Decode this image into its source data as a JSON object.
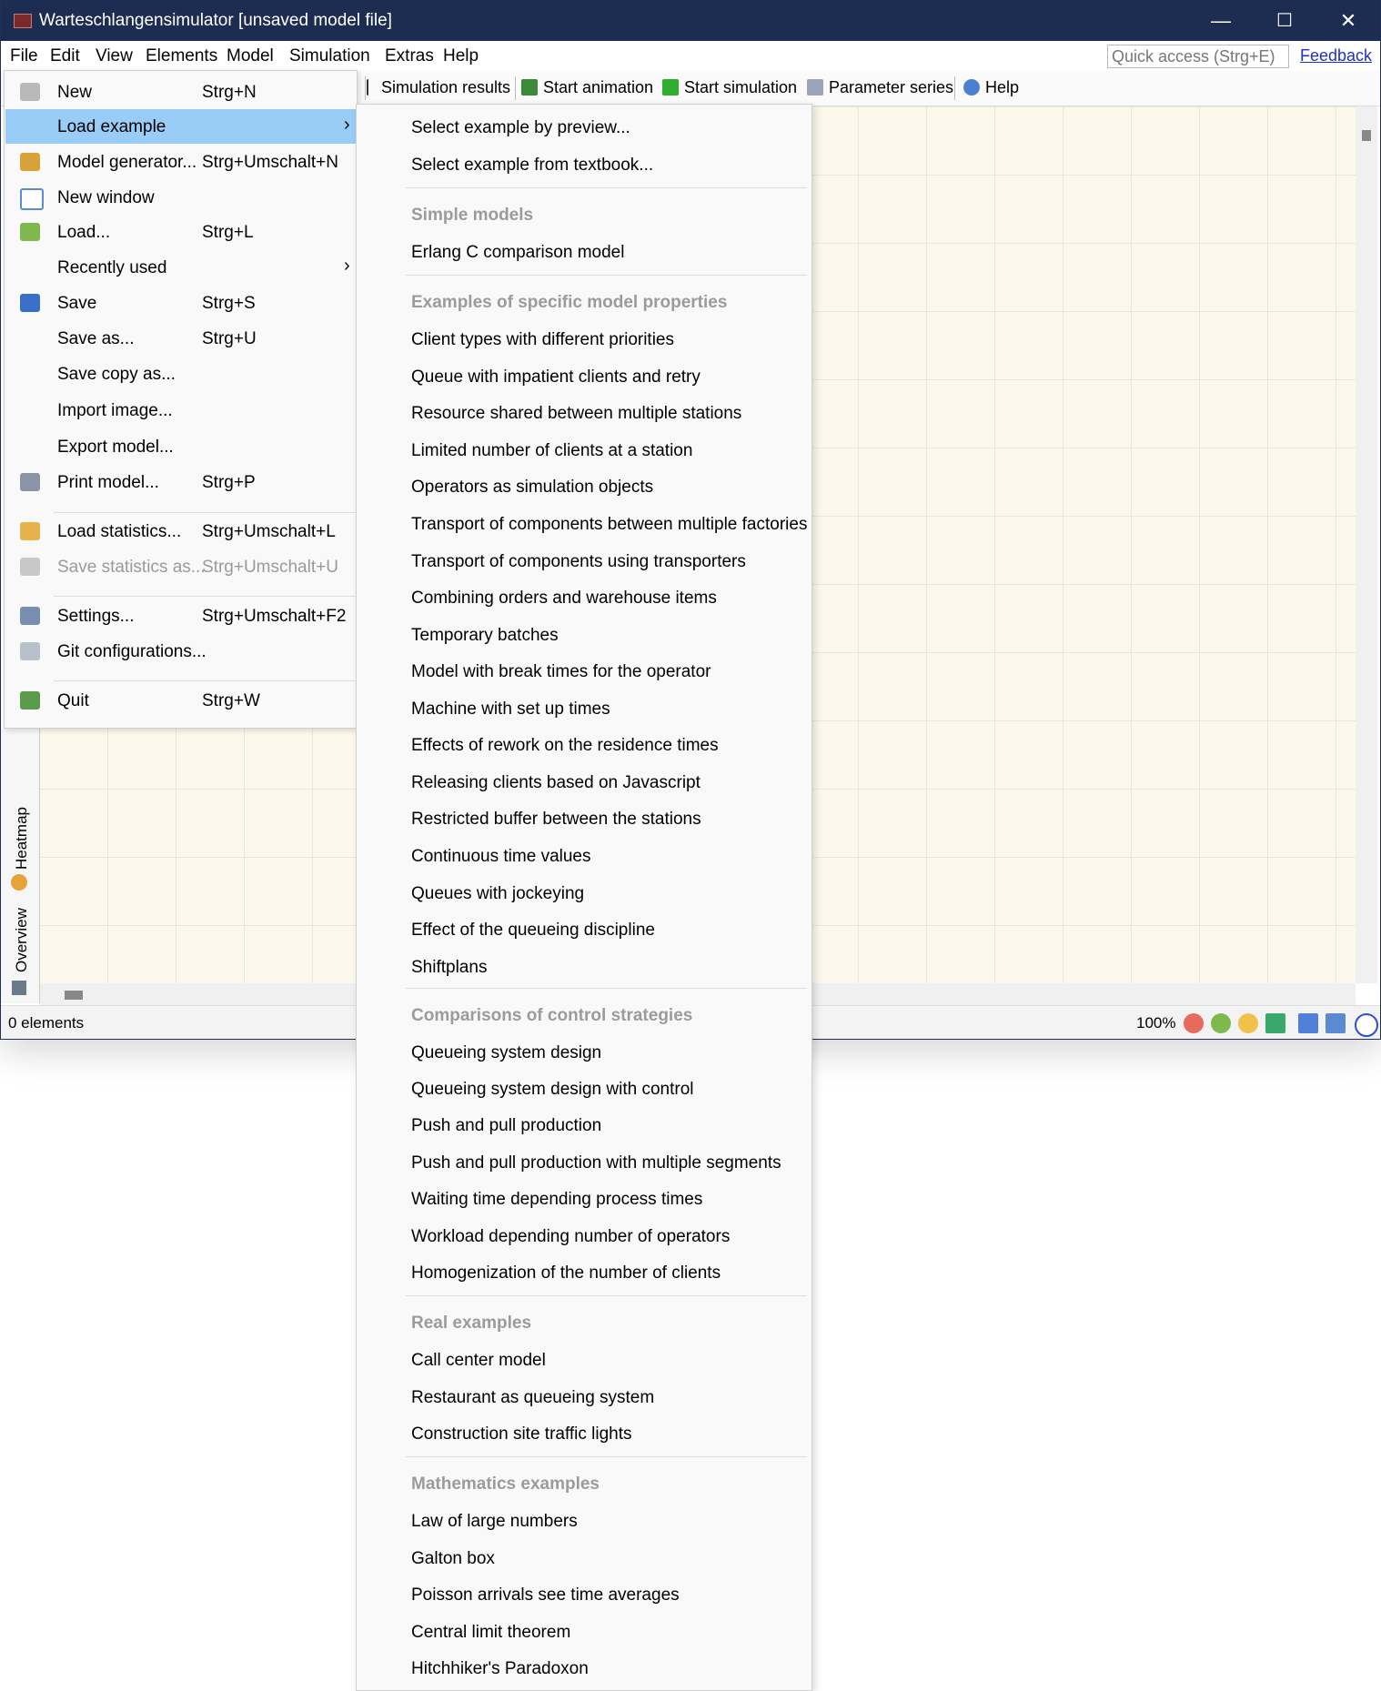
{
  "window": {
    "title": "Warteschlangensimulator [unsaved model file]"
  },
  "window_controls": {
    "minimize": "—",
    "maximize": "☐",
    "close": "✕"
  },
  "menubar": [
    "File",
    "Edit",
    "View",
    "Elements",
    "Model",
    "Simulation",
    "Extras",
    "Help"
  ],
  "quick_access": {
    "placeholder": "Quick access (Strg+E)"
  },
  "feedback": "Feedback",
  "toolbar": {
    "simulation_results": "Simulation results",
    "start_animation": "Start animation",
    "start_simulation": "Start simulation",
    "parameter_series": "Parameter series",
    "help": "Help"
  },
  "file_menu": {
    "items": [
      {
        "label": "New",
        "shortcut": "Strg+N"
      },
      {
        "label": "Load example",
        "shortcut": "",
        "arrow": "›"
      },
      {
        "label": "Model generator...",
        "shortcut": "Strg+Umschalt+N"
      },
      {
        "label": "New window",
        "shortcut": ""
      },
      {
        "label": "Load...",
        "shortcut": "Strg+L"
      },
      {
        "label": "Recently used",
        "shortcut": "",
        "arrow": "›"
      },
      {
        "label": "Save",
        "shortcut": "Strg+S"
      },
      {
        "label": "Save as...",
        "shortcut": "Strg+U"
      },
      {
        "label": "Save copy as...",
        "shortcut": ""
      },
      {
        "label": "Import image...",
        "shortcut": ""
      },
      {
        "label": "Export model...",
        "shortcut": ""
      },
      {
        "label": "Print model...",
        "shortcut": "Strg+P"
      },
      {
        "label": "Load statistics...",
        "shortcut": "Strg+Umschalt+L"
      },
      {
        "label": "Save statistics as...",
        "shortcut": "Strg+Umschalt+U"
      },
      {
        "label": "Settings...",
        "shortcut": "Strg+Umschalt+F2"
      },
      {
        "label": "Git configurations...",
        "shortcut": ""
      },
      {
        "label": "Quit",
        "shortcut": "Strg+W"
      }
    ]
  },
  "submenu": {
    "items": [
      "Select example by preview...",
      "Select example from textbook...",
      "Simple models",
      "Erlang C comparison model",
      "Examples of specific model properties",
      "Client types with different priorities",
      "Queue with impatient clients and retry",
      "Resource shared between multiple stations",
      "Limited number of clients at a station",
      "Operators as simulation objects",
      "Transport of components between multiple factories",
      "Transport of components using transporters",
      "Combining orders and warehouse items",
      "Temporary batches",
      "Model with break times for the operator",
      "Machine with set up times",
      "Effects of rework on the residence times",
      "Releasing clients based on Javascript",
      "Restricted buffer between the stations",
      "Continuous time values",
      "Queues with jockeying",
      "Effect of the queueing discipline",
      "Shiftplans",
      "Comparisons of control strategies",
      "Queueing system design",
      "Queueing system design with control",
      "Push and pull production",
      "Push and pull production with multiple segments",
      "Waiting time depending process times",
      "Workload depending number of operators",
      "Homogenization of the number of clients",
      "Real examples",
      "Call center model",
      "Restaurant as queueing system",
      "Construction site traffic lights",
      "Mathematics examples",
      "Law of large numbers",
      "Galton box",
      "Poisson arrivals see time averages",
      "Central limit theorem",
      "Hitchhiker's Paradoxon"
    ]
  },
  "side_tabs": {
    "heatmap": "Heatmap",
    "overview": "Overview"
  },
  "status": {
    "elements": "0 elements",
    "zoom": "100%"
  },
  "colors": {
    "titlebar": "#1d2d52",
    "highlight": "#99ccf7",
    "canvas": "#fdf8ec",
    "link": "#1e2fd0"
  }
}
